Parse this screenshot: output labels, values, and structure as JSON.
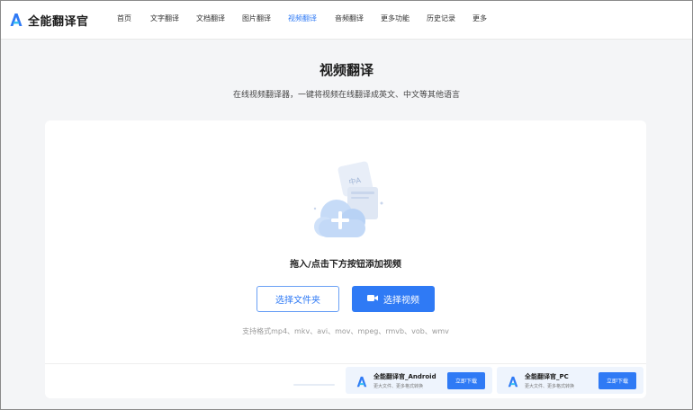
{
  "app": {
    "name": "全能翻译官"
  },
  "nav": {
    "items": [
      {
        "label": "首页"
      },
      {
        "label": "文字翻译"
      },
      {
        "label": "文档翻译"
      },
      {
        "label": "图片翻译"
      },
      {
        "label": "视频翻译",
        "active": true
      },
      {
        "label": "音频翻译"
      },
      {
        "label": "更多功能"
      },
      {
        "label": "历史记录"
      },
      {
        "label": "更多"
      }
    ]
  },
  "page": {
    "title": "视频翻译",
    "subtitle": "在线视频翻译器，一键将视频在线翻译成英文、中文等其他语言"
  },
  "upload": {
    "drop_text": "拖入/点击下方按钮添加视频",
    "folder_button": "选择文件夹",
    "video_button": "选择视频",
    "formats_text": "支持格式mp4、mkv、avi、mov、mpeg、rmvb、vob、wmv"
  },
  "downloads": [
    {
      "title": "全能翻译官_Android",
      "subtitle": "更大文件、更多格式转换",
      "button": "立即下载"
    },
    {
      "title": "全能翻译官_PC",
      "subtitle": "更大文件、更多格式转换",
      "button": "立即下载"
    }
  ],
  "colors": {
    "accent": "#2f7af5",
    "background": "#f4f5f7",
    "card": "#ffffff",
    "banner": "#eef4fd"
  },
  "icons": {
    "logo": "app-logo-icon",
    "upload": "cloud-plus-icon",
    "camera": "video-camera-icon"
  }
}
